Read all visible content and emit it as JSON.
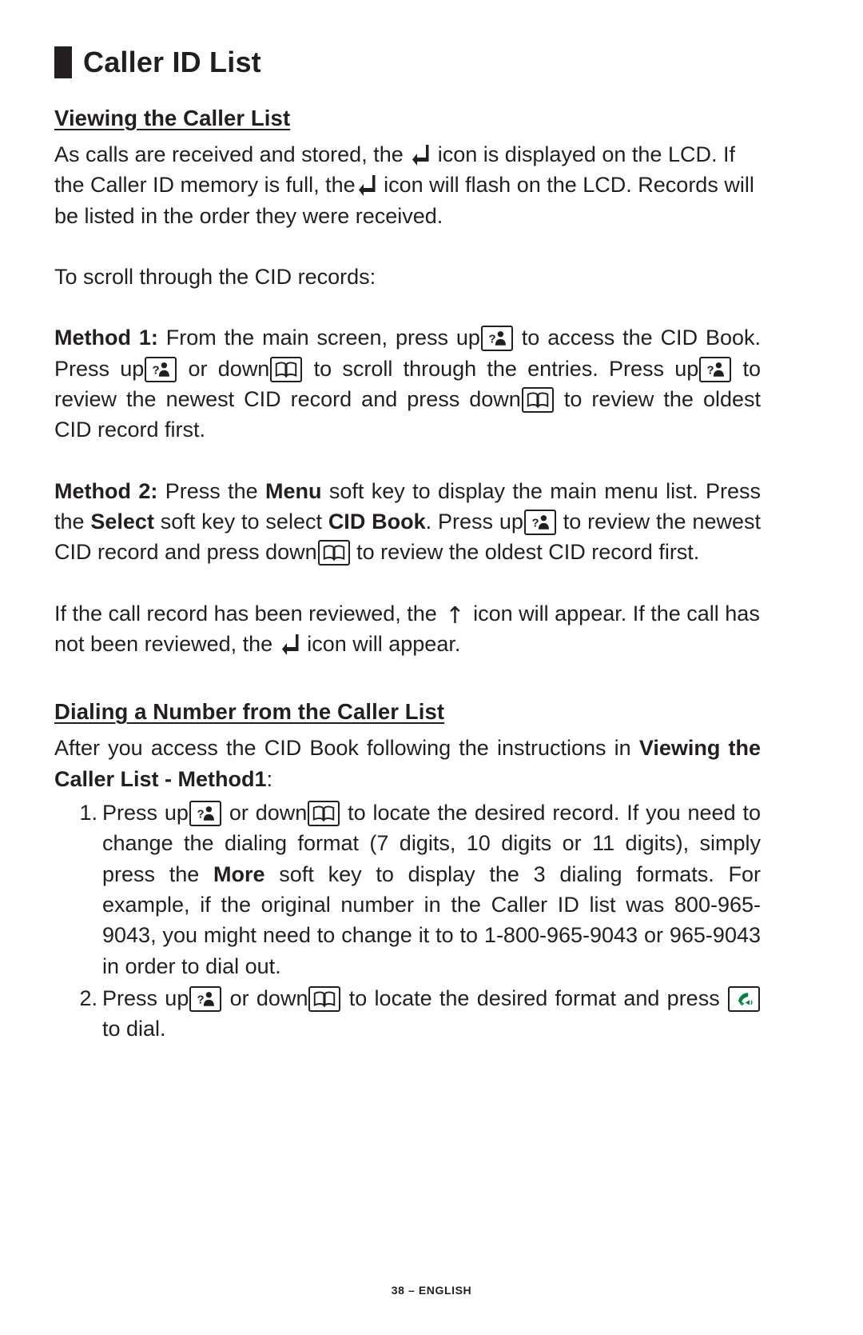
{
  "page": {
    "title": "Caller ID List",
    "footer": "38 – ENGLISH"
  },
  "sections": {
    "viewing": {
      "heading": "Viewing the Caller List",
      "para1_a": "As calls are received and stored, the",
      "para1_b": "icon is displayed on the LCD.  If the Caller ID memory is full, the",
      "para1_c": "icon will flash on the LCD.  Records will be listed in the order they were received.",
      "para2": "To scroll through the CID records:",
      "method1": {
        "label": "Method 1:",
        "t1": " From the main screen, press up",
        "t2": " to access the CID Book.  Press up",
        "t3": " or down",
        "t4": " to scroll through the entries. Press up",
        "t5": " to review the newest CID record and press down",
        "t6": " to review the oldest CID record first."
      },
      "method2": {
        "label": "Method 2:",
        "t1": " Press the ",
        "menu": "Menu",
        "t2": " soft key to display the main menu list.   Press the ",
        "select": "Select",
        "t3": " soft key to select ",
        "cidbook": "CID Book",
        "t4": ".  Press up",
        "t5": " to review the newest CID record and press down",
        "t6": " to review the oldest CID record first."
      },
      "para3_a": "If the call record has been reviewed, the",
      "para3_b": "icon will appear.  If the call has not been reviewed, the",
      "para3_c": "icon will appear."
    },
    "dialing": {
      "heading": "Dialing a Number from the Caller List",
      "intro_a": "After you access the CID Book following the instructions in ",
      "intro_b": "Viewing the Caller List -  Method1",
      "intro_c": ":",
      "steps": [
        {
          "number": "1.",
          "t1": "Press up",
          "t2": " or down",
          "t3": " to locate the desired record. If you need to change the dialing format (7 digits, 10 digits or 11 digits), simply press the ",
          "more": "More",
          "t4": " soft key to display the 3 dialing formats. For example, if the original number in the Caller ID list was 800-965-9043, you might need to change it to to 1-800-965-9043 or 965-9043 in order to dial out."
        },
        {
          "number": "2.",
          "t1": "Press up",
          "t2": " or down",
          "t3": " to locate the desired format and press ",
          "t4": " to dial."
        }
      ]
    }
  },
  "icons": {
    "return": "return-arrow-icon",
    "up_key": "caller-id-person-question-key-icon",
    "down_key": "phonebook-open-book-key-icon",
    "dial_key": "green-talk-handset-key-icon",
    "reviewed_arrow": "↑"
  },
  "colors": {
    "text": "#231f20",
    "dial_green": "#00843d"
  }
}
